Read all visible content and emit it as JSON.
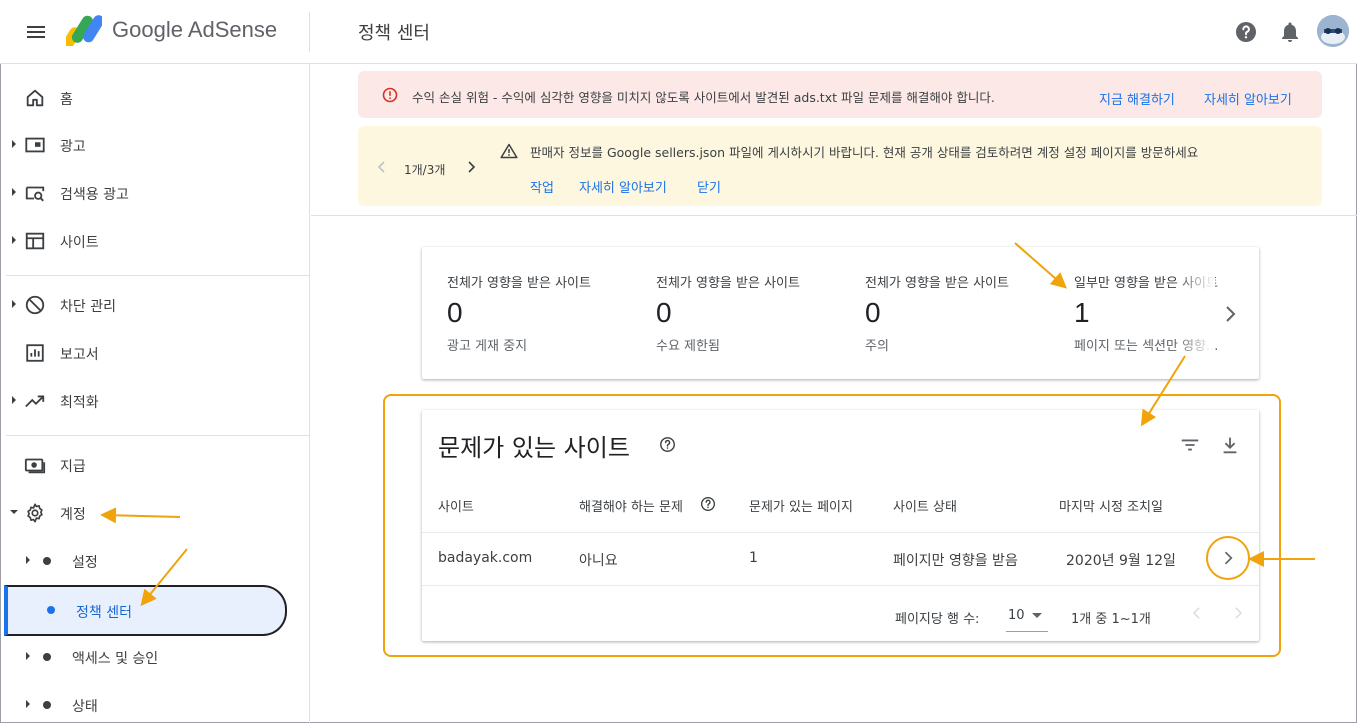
{
  "app": {
    "brand_name": "Google AdSense",
    "page_title": "정책 센터"
  },
  "sidebar": {
    "items": [
      {
        "label": "홈",
        "icon": "home-icon"
      },
      {
        "label": "광고",
        "icon": "ads-icon"
      },
      {
        "label": "검색용 광고",
        "icon": "search-ads-icon"
      },
      {
        "label": "사이트",
        "icon": "sites-icon"
      },
      {
        "label": "차단 관리",
        "icon": "block-icon"
      },
      {
        "label": "보고서",
        "icon": "reports-icon"
      },
      {
        "label": "최적화",
        "icon": "optimize-icon"
      },
      {
        "label": "지급",
        "icon": "payments-icon"
      },
      {
        "label": "계정",
        "icon": "gear-icon"
      }
    ],
    "sub_items": [
      {
        "label": "설정"
      },
      {
        "label": "정책 센터",
        "active": true
      },
      {
        "label": "액세스 및 승인"
      },
      {
        "label": "상태"
      }
    ]
  },
  "banners": {
    "error": {
      "message": "수익 손실 위험 - 수익에 심각한 영향을 미치지 않도록 사이트에서 발견된 ads.txt 파일 문제를 해결해야 합니다.",
      "action_fix": "지금 해결하기",
      "action_learn": "자세히 알아보기",
      "color": "#d93025"
    },
    "warning": {
      "pager": "1개/3개",
      "message": "판매자 정보를 Google sellers.json 파일에 게시하시기 바랍니다. 현재 공개 상태를 검토하려면 계정 설정 페이지를 방문하세요",
      "action_do": "작업",
      "action_learn": "자세히 알아보기",
      "action_close": "닫기"
    }
  },
  "summary": {
    "stats": [
      {
        "label": "전체가 영향을 받은 사이트",
        "value": "0",
        "sub": "광고 게재 중지"
      },
      {
        "label": "전체가 영향을 받은 사이트",
        "value": "0",
        "sub": "수요 제한됨"
      },
      {
        "label": "전체가 영향을 받은 사이트",
        "value": "0",
        "sub": "주의"
      },
      {
        "label": "일부만 영향을 받은 사이트",
        "value": "1",
        "sub": "페이지 또는 섹션만 영향..."
      }
    ]
  },
  "sites_table": {
    "title": "문제가 있는 사이트",
    "columns": [
      "사이트",
      "해결해야 하는 문제",
      "문제가 있는 페이지",
      "사이트 상태",
      "마지막 시정 조치일"
    ],
    "rows": [
      {
        "site": "badayak.com",
        "needs_fix": "아니요",
        "pages": "1",
        "status": "페이지만 영향을 받음",
        "last_action": "2020년 9월 12일"
      }
    ],
    "rows_per_page_label": "페이지당 행 수:",
    "rows_per_page": "10",
    "range": "1개 중 1~1개"
  },
  "colors": {
    "accent": "#1a73e8",
    "highlight": "#f0a30a",
    "error_bg": "#fce8e6",
    "warning_bg": "#fef7e0"
  }
}
